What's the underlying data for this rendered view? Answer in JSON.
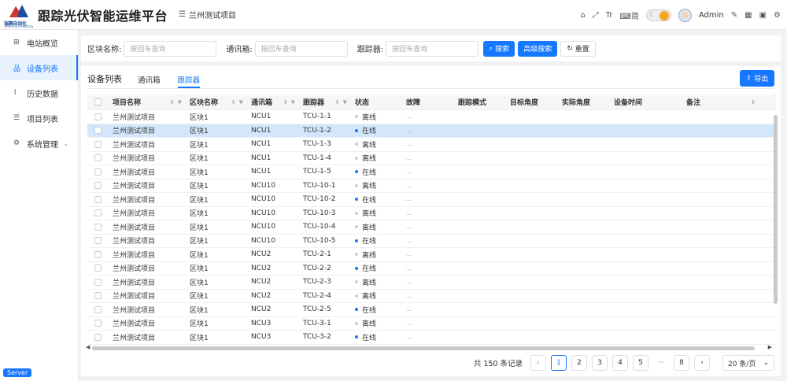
{
  "app": {
    "title": "跟踪光伏智能运维平台",
    "logo_text": "瑞赛自动化",
    "logo_sub": "RUISAI AUTOMATION",
    "breadcrumb": "兰州测试项目",
    "user": "Admin",
    "lang_label": "简"
  },
  "sidebar": {
    "items": [
      {
        "label": "电站概览",
        "icon": "grid-icon"
      },
      {
        "label": "设备列表",
        "icon": "device-icon",
        "active": true
      },
      {
        "label": "历史数据",
        "icon": "chart-icon"
      },
      {
        "label": "项目列表",
        "icon": "list-icon"
      },
      {
        "label": "系统管理",
        "icon": "gear-icon",
        "has_arrow": true
      }
    ],
    "server_badge": "Server"
  },
  "search": {
    "block_label": "区块名称:",
    "block_placeholder": "按回车查询",
    "ncu_label": "通讯箱:",
    "ncu_placeholder": "按回车查询",
    "tcu_label": "跟踪器:",
    "tcu_placeholder": "按回车查询",
    "search_btn": "搜索",
    "advanced_btn": "高级搜索",
    "reset_btn": "重置"
  },
  "tabs": {
    "title": "设备列表",
    "items": [
      "通讯箱",
      "跟踪器"
    ],
    "active": "跟踪器",
    "export_btn": "导出"
  },
  "table": {
    "headers": [
      "项目名称",
      "区块名称",
      "通讯箱",
      "跟踪器",
      "状态",
      "故障",
      "跟踪模式",
      "目标角度",
      "实际角度",
      "设备时间",
      "备注"
    ],
    "rows": [
      {
        "project": "兰州测试项目",
        "block": "区块1",
        "ncu": "NCU1",
        "tcu": "TCU-1-1",
        "status": "离线",
        "online": false
      },
      {
        "project": "兰州测试项目",
        "block": "区块1",
        "ncu": "NCU1",
        "tcu": "TCU-1-2",
        "status": "在线",
        "online": true,
        "selected": true
      },
      {
        "project": "兰州测试项目",
        "block": "区块1",
        "ncu": "NCU1",
        "tcu": "TCU-1-3",
        "status": "离线",
        "online": false
      },
      {
        "project": "兰州测试项目",
        "block": "区块1",
        "ncu": "NCU1",
        "tcu": "TCU-1-4",
        "status": "离线",
        "online": false
      },
      {
        "project": "兰州测试项目",
        "block": "区块1",
        "ncu": "NCU1",
        "tcu": "TCU-1-5",
        "status": "在线",
        "online": true
      },
      {
        "project": "兰州测试项目",
        "block": "区块1",
        "ncu": "NCU10",
        "tcu": "TCU-10-1",
        "status": "离线",
        "online": false
      },
      {
        "project": "兰州测试项目",
        "block": "区块1",
        "ncu": "NCU10",
        "tcu": "TCU-10-2",
        "status": "在线",
        "online": true
      },
      {
        "project": "兰州测试项目",
        "block": "区块1",
        "ncu": "NCU10",
        "tcu": "TCU-10-3",
        "status": "离线",
        "online": false
      },
      {
        "project": "兰州测试项目",
        "block": "区块1",
        "ncu": "NCU10",
        "tcu": "TCU-10-4",
        "status": "离线",
        "online": false
      },
      {
        "project": "兰州测试项目",
        "block": "区块1",
        "ncu": "NCU10",
        "tcu": "TCU-10-5",
        "status": "在线",
        "online": true
      },
      {
        "project": "兰州测试项目",
        "block": "区块1",
        "ncu": "NCU2",
        "tcu": "TCU-2-1",
        "status": "离线",
        "online": false
      },
      {
        "project": "兰州测试项目",
        "block": "区块1",
        "ncu": "NCU2",
        "tcu": "TCU-2-2",
        "status": "在线",
        "online": true
      },
      {
        "project": "兰州测试项目",
        "block": "区块1",
        "ncu": "NCU2",
        "tcu": "TCU-2-3",
        "status": "离线",
        "online": false
      },
      {
        "project": "兰州测试项目",
        "block": "区块1",
        "ncu": "NCU2",
        "tcu": "TCU-2-4",
        "status": "离线",
        "online": false
      },
      {
        "project": "兰州测试项目",
        "block": "区块1",
        "ncu": "NCU2",
        "tcu": "TCU-2-5",
        "status": "在线",
        "online": true
      },
      {
        "project": "兰州测试项目",
        "block": "区块1",
        "ncu": "NCU3",
        "tcu": "TCU-3-1",
        "status": "离线",
        "online": false
      },
      {
        "project": "兰州测试项目",
        "block": "区块1",
        "ncu": "NCU3",
        "tcu": "TCU-3-2",
        "status": "在线",
        "online": true
      }
    ]
  },
  "pagination": {
    "total_text": "共 150 条记录",
    "pages": [
      "1",
      "2",
      "3",
      "4",
      "5"
    ],
    "ellipsis": "···",
    "last_page": "8",
    "current": "1",
    "page_size": "20 条/页"
  },
  "colors": {
    "primary": "#1677ff",
    "online_dot": "#1677ff",
    "offline_dot": "#cccccc",
    "selected_row": "#d3e6fb"
  }
}
